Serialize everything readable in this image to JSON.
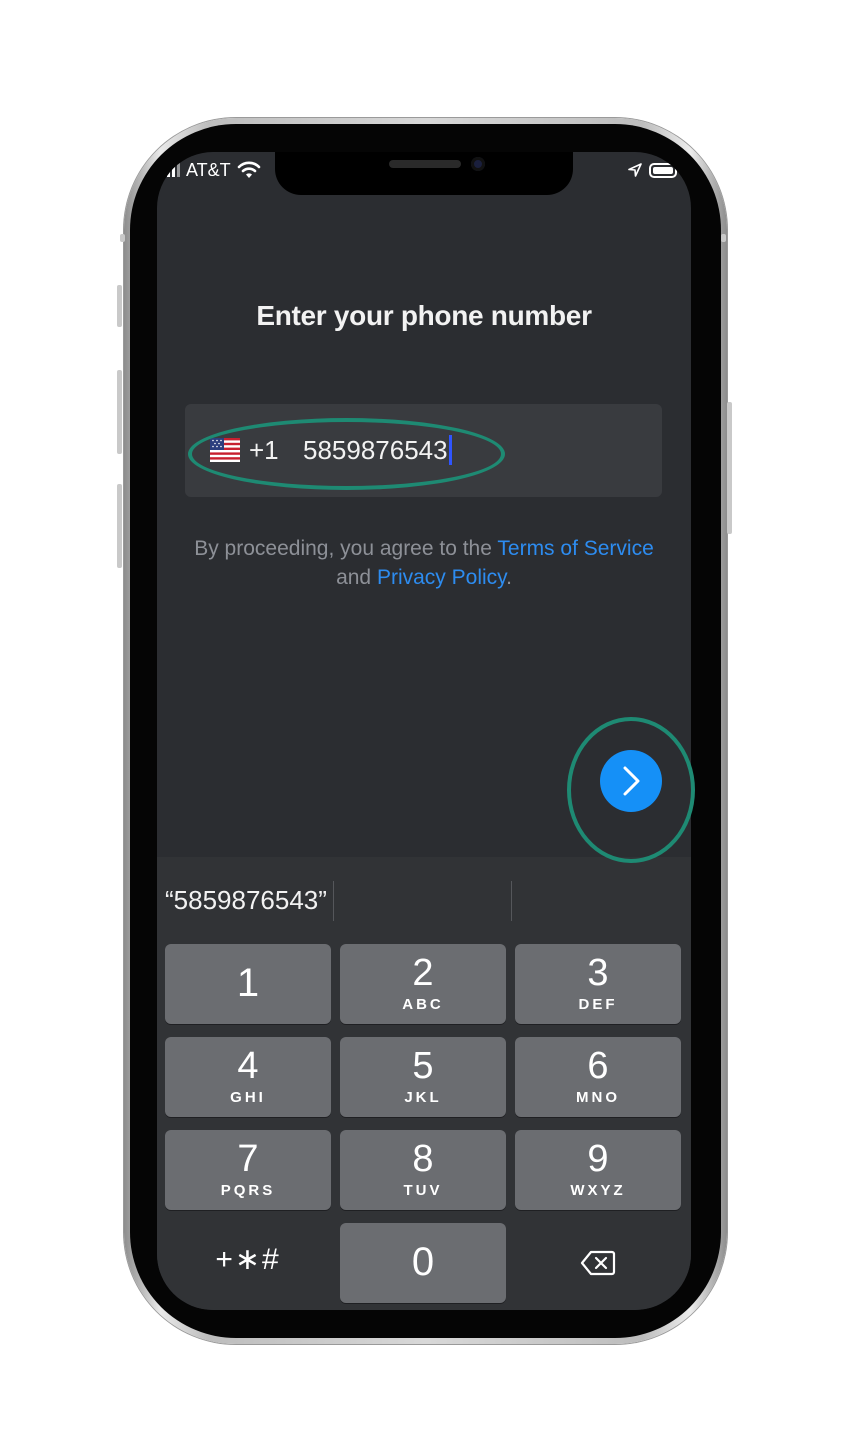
{
  "status_bar": {
    "carrier": "AT&T"
  },
  "header": {
    "title": "Enter your phone number"
  },
  "phone_input": {
    "country_flag": "us-flag-icon",
    "country_code": "+1",
    "number": "5859876543"
  },
  "legal": {
    "prefix": "By proceeding, you agree to the",
    "terms_link": "Terms of Service",
    "and_text": "and",
    "privacy_link": "Privacy Policy",
    "suffix": "."
  },
  "next_button": {
    "icon": "chevron-right-icon"
  },
  "keyboard": {
    "suggestion": "“5859876543”",
    "keys": [
      {
        "digit": "1",
        "letters": ""
      },
      {
        "digit": "2",
        "letters": "ABC"
      },
      {
        "digit": "3",
        "letters": "DEF"
      },
      {
        "digit": "4",
        "letters": "GHI"
      },
      {
        "digit": "5",
        "letters": "JKL"
      },
      {
        "digit": "6",
        "letters": "MNO"
      },
      {
        "digit": "7",
        "letters": "PQRS"
      },
      {
        "digit": "8",
        "letters": "TUV"
      },
      {
        "digit": "9",
        "letters": "WXYZ"
      },
      {
        "digit": "0",
        "letters": ""
      }
    ],
    "symbols_label": "+∗#",
    "delete_icon": "backspace-icon"
  },
  "colors": {
    "screen_bg": "#2b2d31",
    "field_bg": "#393b3f",
    "link": "#2d8cf0",
    "accent_button": "#1590f7",
    "highlight_ring": "#1e8a73",
    "key_bg": "#6b6d71"
  }
}
